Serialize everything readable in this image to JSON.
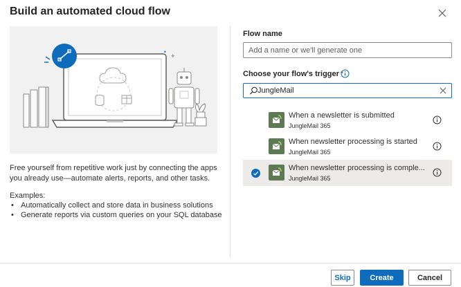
{
  "dialog": {
    "title": "Build an automated cloud flow"
  },
  "intro": {
    "description": "Free yourself from repetitive work just by connecting the apps you already use—automate alerts, reports, and other tasks.",
    "examples_title": "Examples:",
    "examples": [
      "Automatically collect and store data in business solutions",
      "Generate reports via custom queries on your SQL database"
    ]
  },
  "flow_name": {
    "label": "Flow name",
    "placeholder": "Add a name or we'll generate one",
    "value": ""
  },
  "trigger_section": {
    "label": "Choose your flow's trigger",
    "required": "*"
  },
  "search": {
    "value": "JungleMail"
  },
  "triggers": [
    {
      "title": "When a newsletter is submitted",
      "connector": "JungleMail 365",
      "selected": false
    },
    {
      "title": "When newsletter processing is started",
      "connector": "JungleMail 365",
      "selected": false
    },
    {
      "title": "When newsletter processing is comple...",
      "connector": "JungleMail 365",
      "selected": true
    }
  ],
  "footer": {
    "skip_label": "Skip",
    "create_label": "Create",
    "cancel_label": "Cancel"
  },
  "colors": {
    "accent": "#0f6cbd",
    "selected_row": "#edebe9",
    "connector_logo": "#5e7a55",
    "hero_background": "#f1f1f1"
  }
}
